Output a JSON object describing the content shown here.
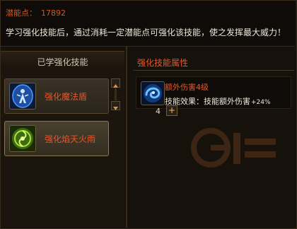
{
  "header": {
    "points_label": "潜能点：",
    "points_value": "17892",
    "description": "学习强化技能后，通过消耗一定潜能点可强化该技能，使之发挥最大威力！"
  },
  "left_panel": {
    "title": "已学强化技能",
    "skills": [
      {
        "name": "强化魔法盾",
        "icon": "magic-shield-icon"
      },
      {
        "name": "强化焰天火雨",
        "icon": "fire-rain-icon"
      }
    ]
  },
  "right_panel": {
    "title": "强化技能属性",
    "attribute": {
      "icon": "swirl-blue-icon",
      "name": "额外伤害4级",
      "effect_label": "技能效果：",
      "effect_value": "技能额外伤害",
      "effect_bonus": "+24%",
      "level": "4",
      "plus_label": "+"
    }
  },
  "colors": {
    "accent_orange": "#e8572a",
    "points_red": "#d25a1e",
    "panel_bg": "#17110c",
    "text_light": "#ece6da"
  }
}
